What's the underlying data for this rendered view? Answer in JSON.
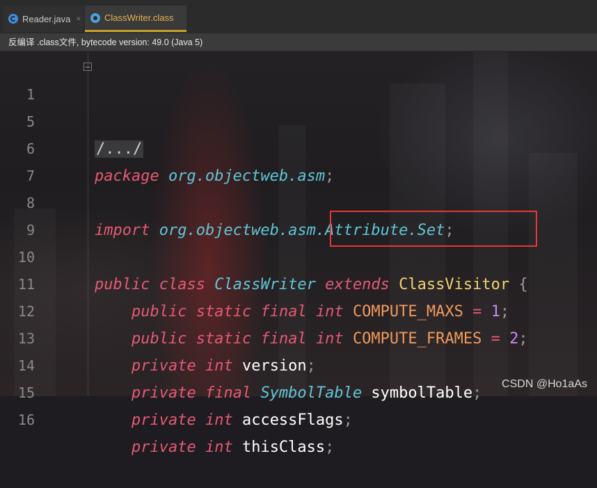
{
  "tabs": [
    {
      "label": "Reader.java",
      "close": "×"
    },
    {
      "label": "ClassWriter.class"
    }
  ],
  "info_bar": "反编译 .class文件, bytecode version: 49.0 (Java 5)",
  "lines": {
    "l1": {
      "num": "1",
      "folded": "/.../"
    },
    "l5": {
      "num": "5"
    },
    "l6": {
      "num": "6",
      "kw": "package",
      "pkg": "org.objectweb.asm",
      "semi": ";"
    },
    "l7": {
      "num": "7"
    },
    "l8": {
      "num": "8",
      "kw": "import",
      "pkg": "org.objectweb.asm.Attribute.Set",
      "semi": ";"
    },
    "l9": {
      "num": "9"
    },
    "l10": {
      "num": "10",
      "kw1": "public",
      "kw2": "class",
      "cls": "ClassWriter",
      "kw3": "extends",
      "sup": "ClassVisitor",
      "brace": "{"
    },
    "l11": {
      "num": "11",
      "kw1": "public",
      "kw2": "static",
      "kw3": "final",
      "kw4": "int",
      "name": "COMPUTE_MAXS",
      "eq": "=",
      "val": "1",
      "semi": ";"
    },
    "l12": {
      "num": "12",
      "kw1": "public",
      "kw2": "static",
      "kw3": "final",
      "kw4": "int",
      "name": "COMPUTE_FRAMES",
      "eq": "=",
      "val": "2",
      "semi": ";"
    },
    "l13": {
      "num": "13",
      "kw1": "private",
      "kw2": "int",
      "name": "version",
      "semi": ";"
    },
    "l14": {
      "num": "14",
      "kw1": "private",
      "kw2": "final",
      "typ": "SymbolTable",
      "name": "symbolTable",
      "semi": ";"
    },
    "l15": {
      "num": "15",
      "kw1": "private",
      "kw2": "int",
      "name": "accessFlags",
      "semi": ";"
    },
    "l16": {
      "num": "16",
      "kw1": "private",
      "kw2": "int",
      "name": "thisClass",
      "semi": ";"
    }
  },
  "watermark": "CSDN @Ho1aAs",
  "colors": {
    "keyword": "#e55a75",
    "package": "#5ec7d6",
    "class_name": "#f4d06f",
    "constant": "#f29a5b",
    "number": "#c58cf0",
    "highlight_box": "#e53935"
  }
}
